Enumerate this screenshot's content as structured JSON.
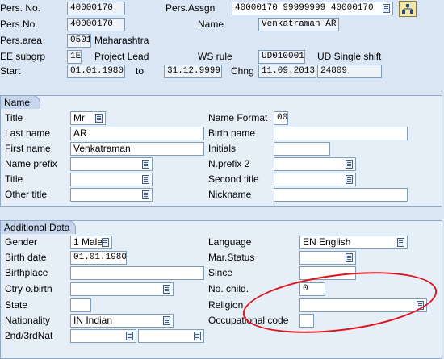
{
  "header": {
    "pers_no_label": "Pers. No.",
    "pers_no_value": "40000170",
    "pers_assgn_label": "Pers.Assgn",
    "pers_assgn_value": "40000170 99999999 40000170",
    "pers_no2_label": "Pers.No.",
    "pers_no2_value": "40000170",
    "name_label": "Name",
    "name_value": "Venkatraman AR",
    "pers_area_label": "Pers.area",
    "pers_area_code": "0501",
    "pers_area_text": "Maharashtra",
    "ee_subgrp_label": "EE subgrp",
    "ee_subgrp_code": "1E",
    "ee_subgrp_text": "Project Lead",
    "ws_rule_label": "WS rule",
    "ws_rule_code": "UD010001",
    "ws_rule_text": "UD Single shift",
    "start_label": "Start",
    "start_value": "01.01.1980",
    "to_label": "to",
    "to_value": "31.12.9999",
    "chng_label": "Chng",
    "chng_date": "11.09.2013",
    "chng_user": "24809"
  },
  "name_section": {
    "title": "Name",
    "title_label": "Title",
    "title_value": "Mr",
    "name_format_label": "Name Format",
    "name_format_value": "00",
    "last_name_label": "Last name",
    "last_name_value": "AR",
    "birth_name_label": "Birth name",
    "birth_name_value": "",
    "first_name_label": "First name",
    "first_name_value": "Venkatraman",
    "initials_label": "Initials",
    "initials_value": "",
    "name_prefix_label": "Name prefix",
    "name_prefix_value": "",
    "nprefix2_label": "N.prefix 2",
    "nprefix2_value": "",
    "title2_label": "Title",
    "title2_value": "",
    "second_title_label": "Second title",
    "second_title_value": "",
    "other_title_label": "Other title",
    "other_title_value": "",
    "nickname_label": "Nickname",
    "nickname_value": ""
  },
  "additional_section": {
    "title": "Additional Data",
    "gender_label": "Gender",
    "gender_value": "1 Male",
    "language_label": "Language",
    "language_value": "EN English",
    "birth_date_label": "Birth date",
    "birth_date_value": "01.01.1980",
    "mar_status_label": "Mar.Status",
    "mar_status_value": "",
    "birthplace_label": "Birthplace",
    "birthplace_value": "",
    "since_label": "Since",
    "since_value": "",
    "ctry_birth_label": "Ctry o.birth",
    "ctry_birth_value": "",
    "no_child_label": "No. child.",
    "no_child_value": "0",
    "state_label": "State",
    "state_value": "",
    "religion_label": "Religion",
    "religion_value": "",
    "nationality_label": "Nationality",
    "nationality_value": "IN Indian",
    "occupational_code_label": "Occupational code",
    "occupational_code_value": "",
    "nat2_label": "2nd/3rdNat",
    "nat2_value": "",
    "nat3_value": ""
  },
  "icons": {
    "f4_help": "value-help-icon",
    "org_structure": "org-structure-icon"
  },
  "colors": {
    "background": "#dbe6f4",
    "panel": "#e6eef8",
    "highlight_ellipse": "#e0141c"
  }
}
